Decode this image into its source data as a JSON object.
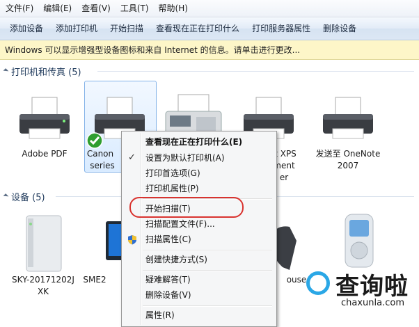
{
  "menubar": {
    "items": [
      {
        "label": "文件(F)"
      },
      {
        "label": "编辑(E)"
      },
      {
        "label": "查看(V)"
      },
      {
        "label": "工具(T)"
      },
      {
        "label": "帮助(H)"
      }
    ]
  },
  "toolbar": {
    "items": [
      {
        "label": "添加设备"
      },
      {
        "label": "添加打印机"
      },
      {
        "label": "开始扫描"
      },
      {
        "label": "查看现在正在打印什么"
      },
      {
        "label": "打印服务器属性"
      },
      {
        "label": "删除设备"
      }
    ]
  },
  "infobar": {
    "text": "Windows 可以显示增强型设备图标和来自 Internet 的信息。请单击进行更改..."
  },
  "groups": {
    "printers": {
      "title": "打印机和传真 (5)"
    },
    "devices": {
      "title": "设备 (5)"
    }
  },
  "printers": [
    {
      "line1": "Adobe PDF",
      "line2": ""
    },
    {
      "line1": "Canon",
      "line2": "series"
    },
    {
      "line1": "",
      "line2": ""
    },
    {
      "line1": "ft XPS",
      "line2": "ment",
      "line3": "er"
    },
    {
      "line1": "发送至 OneNote",
      "line2": "2007"
    }
  ],
  "devices": [
    {
      "line1": "SKY-20171202J",
      "line2": "XK"
    },
    {
      "line1": "SME2"
    },
    {
      "line1": "ouse"
    }
  ],
  "context_menu": {
    "items": [
      {
        "label": "查看现在正在打印什么(E)",
        "bold": true
      },
      {
        "label": "设置为默认打印机(A)",
        "checked": true
      },
      {
        "label": "打印首选项(G)"
      },
      {
        "label": "打印机属性(P)"
      },
      {
        "label": "开始扫描(T)"
      },
      {
        "label": "扫描配置文件(F)..."
      },
      {
        "label": "扫描属性(C)"
      },
      {
        "label": "创建快捷方式(S)"
      },
      {
        "label": "疑难解答(T)"
      },
      {
        "label": "删除设备(V)"
      },
      {
        "label": "属性(R)"
      }
    ]
  },
  "watermark": {
    "big": "查询啦",
    "small": "chaxunla.com"
  },
  "colors": {
    "highlight_ring": "#d9332f",
    "watermark_accent": "#2aa7e6",
    "selection": "#84b3e8"
  }
}
